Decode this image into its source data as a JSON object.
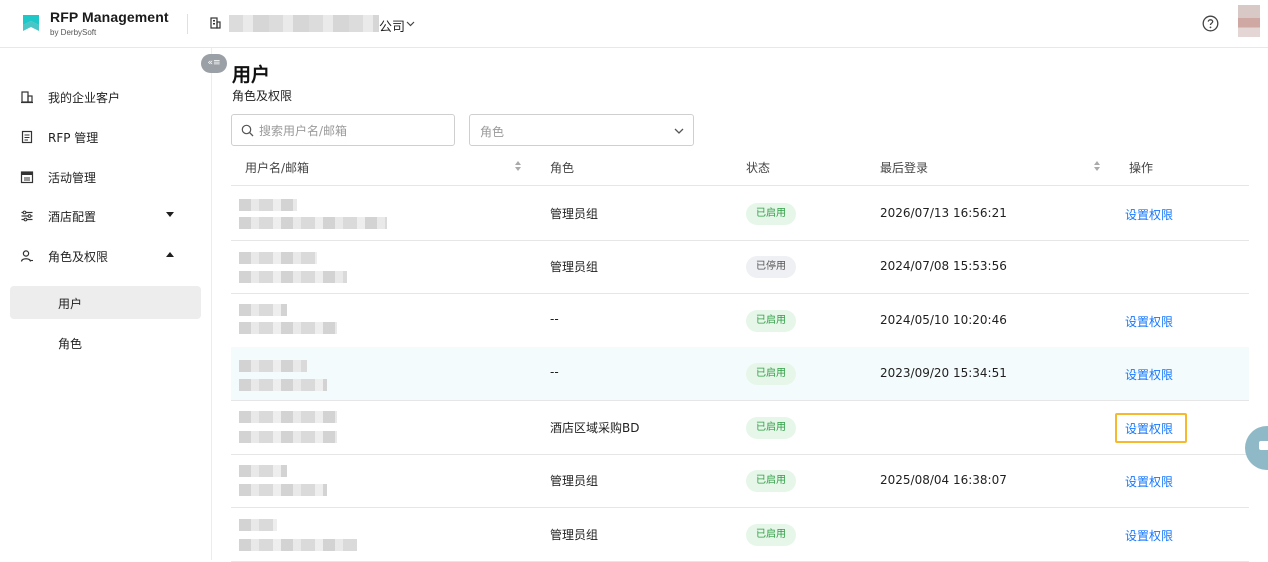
{
  "app": {
    "title": "RFP Management",
    "subtitle": "by DerbySoft",
    "company_suffix": "公司"
  },
  "sidebar": {
    "collapse_label": "«≡",
    "items": [
      {
        "label": "我的企业客户",
        "icon": "building-icon"
      },
      {
        "label": "RFP 管理",
        "icon": "document-icon"
      },
      {
        "label": "活动管理",
        "icon": "calendar-icon"
      },
      {
        "label": "酒店配置",
        "icon": "sliders-icon",
        "caret": "down"
      },
      {
        "label": "角色及权限",
        "icon": "user-icon",
        "caret": "up"
      }
    ],
    "sub_items": [
      {
        "label": "用户",
        "active": true
      },
      {
        "label": "角色",
        "active": false
      }
    ]
  },
  "page": {
    "title": "用户",
    "subtitle": "角色及权限"
  },
  "filters": {
    "search_placeholder": "搜索用户名/邮箱",
    "role_placeholder": "角色"
  },
  "table": {
    "headers": {
      "user": "用户名/邮箱",
      "role": "角色",
      "status": "状态",
      "last_login": "最后登录",
      "actions": "操作"
    },
    "rows": [
      {
        "role": "管理员组",
        "status": "已启用",
        "status_type": "on",
        "last_login": "2026/07/13 16:56:21",
        "action": "设置权限"
      },
      {
        "role": "管理员组",
        "status": "已停用",
        "status_type": "off",
        "last_login": "2024/07/08 15:53:56",
        "action": ""
      },
      {
        "role": "--",
        "status": "已启用",
        "status_type": "on",
        "last_login": "2024/05/10 10:20:46",
        "action": "设置权限"
      },
      {
        "role": "--",
        "status": "已启用",
        "status_type": "on",
        "last_login": "2023/09/20 15:34:51",
        "action": "设置权限"
      },
      {
        "role": "酒店区域采购BD",
        "status": "已启用",
        "status_type": "on",
        "last_login": "",
        "action": "设置权限"
      },
      {
        "role": "管理员组",
        "status": "已启用",
        "status_type": "on",
        "last_login": "2025/08/04 16:38:07",
        "action": "设置权限"
      },
      {
        "role": "管理员组",
        "status": "已启用",
        "status_type": "on",
        "last_login": "",
        "action": "设置权限"
      }
    ]
  },
  "colors": {
    "accent": "#1677ff",
    "brand": "#1ec8c8",
    "enabled_bg": "#e6f7ea",
    "enabled_text": "#2f9e44",
    "focus_outline": "#f5b82e"
  }
}
